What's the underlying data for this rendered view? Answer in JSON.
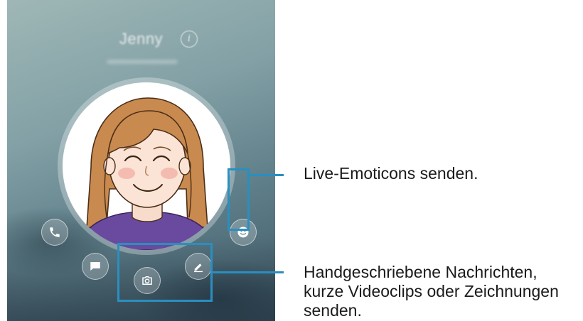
{
  "call": {
    "contact_name": "Jenny",
    "info_glyph": "i"
  },
  "icons": {
    "phone": "phone-icon",
    "message": "message-icon",
    "camera": "camera-icon",
    "pen": "pen-icon",
    "emoticon": "smiley-icon",
    "info": "info-icon"
  },
  "annotations": {
    "emoticons": "Live-Emoticons senden.",
    "handwriting_line1": "Handgeschriebene Nachrichten,",
    "handwriting_line2": "kurze Videoclips oder Zeichnungen",
    "handwriting_line3": "senden."
  },
  "colors": {
    "highlight": "#2a8fc0",
    "text": "#1a1a1a"
  }
}
